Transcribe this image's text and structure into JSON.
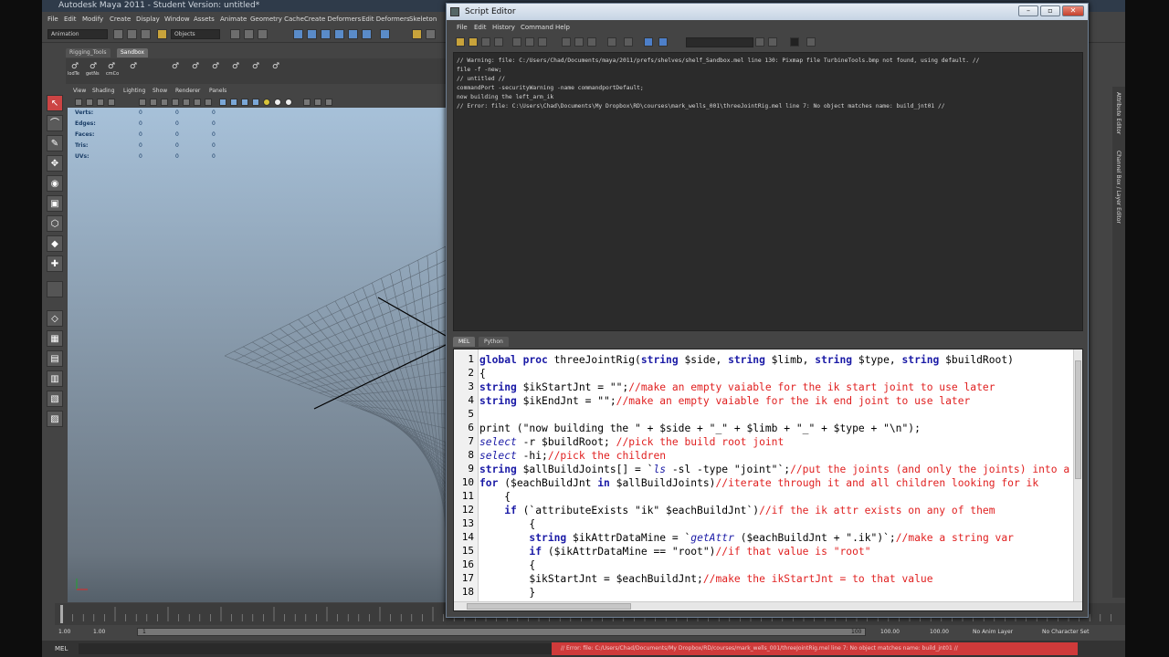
{
  "maya": {
    "title": "Autodesk Maya 2011 - Student Version: untitled*",
    "menu": [
      "File",
      "Edit",
      "Modify",
      "Create",
      "Display",
      "Window",
      "Assets",
      "Animate",
      "Geometry Cache",
      "Create Deformers",
      "Edit Deformers",
      "Skeleton"
    ],
    "mode_dropdown": "Animation",
    "objects_field": "Objects",
    "shelf_tabs": [
      "Rigging_Tools",
      "Sandbox"
    ],
    "shelf_labels": [
      "lodTe",
      "getNs",
      "cmCo"
    ],
    "panel_menu": [
      "View",
      "Shading",
      "Lighting",
      "Show",
      "Renderer",
      "Panels"
    ],
    "hud": {
      "rows": [
        {
          "label": "Verts:",
          "values": [
            "0",
            "0",
            "0"
          ]
        },
        {
          "label": "Edges:",
          "values": [
            "0",
            "0",
            "0"
          ]
        },
        {
          "label": "Faces:",
          "values": [
            "0",
            "0",
            "0"
          ]
        },
        {
          "label": "Tris:",
          "values": [
            "0",
            "0",
            "0"
          ]
        },
        {
          "label": "UVs:",
          "values": [
            "0",
            "0",
            "0"
          ]
        }
      ]
    },
    "range": {
      "start": "1.00",
      "start2": "1.00",
      "current": "1",
      "end_marker": "100",
      "end": "100.00",
      "end2": "100.00"
    },
    "anim_layer": "No Anim Layer",
    "char_set": "No Character Set",
    "cmd_lang": "MEL",
    "error_bar": "// Error: file: C:/Users/Chad/Documents/My Dropbox/RD/courses/mark_wells_001/threeJointRig.mel line 7: No object matches name: build_jnt01 //",
    "side_labels": [
      "Attribute Editor",
      "Channel Box / Layer Editor"
    ]
  },
  "script_editor": {
    "title": "Script Editor",
    "menu": [
      "File",
      "Edit",
      "History",
      "Command",
      "Help"
    ],
    "history": [
      "// Warning: file: C:/Users/Chad/Documents/maya/2011/prefs/shelves/shelf_Sandbox.mel line 130: Pixmap file TurbineTools.bmp not found, using default. //",
      "file -f -new;",
      "// untitled //",
      "commandPort -securityWarning -name commandportDefault;",
      "now building the left_arm_ik",
      "// Error: file: C:\\Users\\Chad\\Documents\\My Dropbox\\RD\\courses\\mark_wells_001\\threeJointRig.mel line 7: No object matches name: build_jnt01 //"
    ],
    "tabs": [
      "MEL",
      "Python"
    ],
    "line_numbers": [
      "1",
      "2",
      "3",
      "4",
      "5",
      "6",
      "7",
      "8",
      "9",
      "10",
      "11",
      "12",
      "13",
      "14",
      "15",
      "16",
      "17",
      "18"
    ],
    "code": [
      [
        {
          "t": "kw",
          "v": "global proc "
        },
        {
          "t": "tx",
          "v": "threeJointRig("
        },
        {
          "t": "kw",
          "v": "string "
        },
        {
          "t": "tx",
          "v": "$side, "
        },
        {
          "t": "kw",
          "v": "string "
        },
        {
          "t": "tx",
          "v": "$limb, "
        },
        {
          "t": "kw",
          "v": "string "
        },
        {
          "t": "tx",
          "v": "$type, "
        },
        {
          "t": "kw",
          "v": "string "
        },
        {
          "t": "tx",
          "v": "$buildRoot)"
        }
      ],
      [
        {
          "t": "tx",
          "v": "{"
        }
      ],
      [
        {
          "t": "kw",
          "v": "string "
        },
        {
          "t": "tx",
          "v": "$ikStartJnt = \"\";"
        },
        {
          "t": "cm",
          "v": "//make an empty vaiable for the ik start joint to use later"
        }
      ],
      [
        {
          "t": "kw",
          "v": "string "
        },
        {
          "t": "tx",
          "v": "$ikEndJnt = \"\";"
        },
        {
          "t": "cm",
          "v": "//make an empty vaiable for the ik end joint to use later"
        }
      ],
      [],
      [
        {
          "t": "tx",
          "v": "print (\"now building the \" + $side + \"_\" + $limb + \"_\" + $type + \"\\n\");"
        }
      ],
      [
        {
          "t": "fn",
          "v": "select "
        },
        {
          "t": "tx",
          "v": "-r $buildRoot; "
        },
        {
          "t": "cm",
          "v": "//pick the build root joint"
        }
      ],
      [
        {
          "t": "fn",
          "v": "select "
        },
        {
          "t": "tx",
          "v": "-hi;"
        },
        {
          "t": "cm",
          "v": "//pick the children"
        }
      ],
      [
        {
          "t": "kw",
          "v": "string "
        },
        {
          "t": "tx",
          "v": "$allBuildJoints[] = `"
        },
        {
          "t": "fn",
          "v": "ls "
        },
        {
          "t": "tx",
          "v": "-sl -type \"joint\"`;"
        },
        {
          "t": "cm",
          "v": "//put the joints (and only the joints) into a variable"
        }
      ],
      [
        {
          "t": "kw",
          "v": "for "
        },
        {
          "t": "tx",
          "v": "($eachBuildJnt "
        },
        {
          "t": "kw",
          "v": "in "
        },
        {
          "t": "tx",
          "v": "$allBuildJoints)"
        },
        {
          "t": "cm",
          "v": "//iterate through it and all children looking for ik"
        }
      ],
      [
        {
          "t": "tx",
          "v": "    {"
        }
      ],
      [
        {
          "t": "kw",
          "v": "    if "
        },
        {
          "t": "tx",
          "v": "(`attributeExists \"ik\" $eachBuildJnt`)"
        },
        {
          "t": "cm",
          "v": "//if the ik attr exists on any of them"
        }
      ],
      [
        {
          "t": "tx",
          "v": "        {"
        }
      ],
      [
        {
          "t": "kw",
          "v": "        string "
        },
        {
          "t": "tx",
          "v": "$ikAttrDataMine = `"
        },
        {
          "t": "fn",
          "v": "getAttr "
        },
        {
          "t": "tx",
          "v": "($eachBuildJnt + \".ik\")`;"
        },
        {
          "t": "cm",
          "v": "//make a string var"
        }
      ],
      [
        {
          "t": "kw",
          "v": "        if "
        },
        {
          "t": "tx",
          "v": "($ikAttrDataMine == \"root\")"
        },
        {
          "t": "cm",
          "v": "//if that value is \"root\""
        }
      ],
      [
        {
          "t": "tx",
          "v": "        {"
        }
      ],
      [
        {
          "t": "tx",
          "v": "        $ikStartJnt = $eachBuildJnt;"
        },
        {
          "t": "cm",
          "v": "//make the ikStartJnt = to that value"
        }
      ],
      [
        {
          "t": "tx",
          "v": "        }"
        }
      ]
    ]
  }
}
